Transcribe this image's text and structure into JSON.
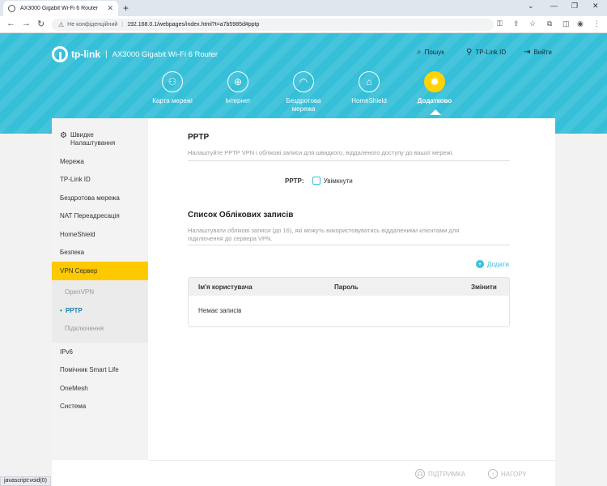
{
  "browser": {
    "tab_title": "AX3000 Gigabit Wi-Fi 6 Router",
    "not_secure": "Не конфіденційний",
    "url": "192.168.0.1/webpages/index.html?t=a7b5985d#pptp",
    "status_text": "javascript:void(0)"
  },
  "header": {
    "brand": "tp-link",
    "model": "AX3000 Gigabit Wi-Fi 6 Router",
    "search": "Пошук",
    "tplink_id": "TP-Link ID",
    "logout": "Вийти",
    "nav": [
      {
        "label": "Карта мережі",
        "icon": "network-map-icon"
      },
      {
        "label": "Інтернет",
        "icon": "globe-icon"
      },
      {
        "label": "Бездротова мережа",
        "icon": "wifi-icon"
      },
      {
        "label": "HomeShield",
        "icon": "homeshield-icon"
      },
      {
        "label": "Додатково",
        "icon": "gear-icon"
      }
    ],
    "accent": "#35bfd8",
    "active_color": "#ffd400"
  },
  "sidebar": {
    "quick_setup": "Швидке Налаштування",
    "items": [
      "Мережа",
      "TP-Link ID",
      "Бездротова мережа",
      "NAT Переадресація",
      "HomeShield",
      "Безпека"
    ],
    "vpn": "VPN Сервер",
    "vpn_sub": [
      "OpenVPN",
      "PPTP",
      "Підключення"
    ],
    "items_after": [
      "IPv6",
      "Помічник Smart Life",
      "OneMesh",
      "Система"
    ]
  },
  "main": {
    "pptp_title": "PPTP",
    "pptp_desc": "Налаштуйте PPTP VPN і облікові записи для швидкого, віддаленого доступу до вашої мережі.",
    "pptp_label": "PPTP:",
    "enable_label": "Увімкнути",
    "accounts_title": "Список Облікових записів",
    "accounts_desc": "Налаштувати облікові записи (до 16), які можуть використовуватись віддаленими клієнтами для підключення до сервера VPN.",
    "add_label": "Додати",
    "columns": [
      "Ім'я користувача",
      "Пароль",
      "Змінити"
    ],
    "empty_text": "Немає записів"
  },
  "footer": {
    "support": "ПІДТРИМКА",
    "top": "НАГОРУ"
  }
}
